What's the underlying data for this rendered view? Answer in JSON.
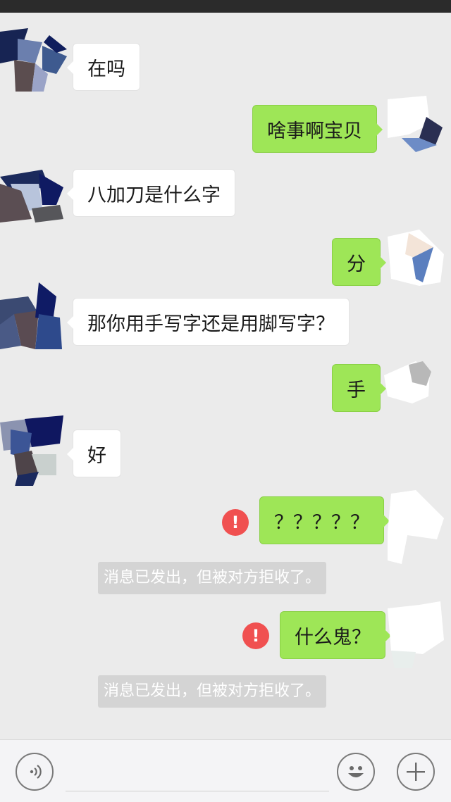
{
  "messages": [
    {
      "side": "in",
      "text": "在吗"
    },
    {
      "side": "out",
      "text": "啥事啊宝贝"
    },
    {
      "side": "in",
      "text": "八加刀是什么字"
    },
    {
      "side": "out",
      "text": "分"
    },
    {
      "side": "in",
      "text": "那你用手写字还是用脚写字？"
    },
    {
      "side": "out",
      "text": "手"
    },
    {
      "side": "in",
      "text": "好"
    },
    {
      "side": "out",
      "text": "？？？？？",
      "status": "failed"
    },
    {
      "side": "out",
      "text": "什么鬼？",
      "status": "failed"
    }
  ],
  "system_notes": [
    "消息已发出，但被对方拒收了。",
    "消息已发出，但被对方拒收了。"
  ],
  "error_icon_glyph": "!",
  "input_bar": {
    "voice_icon": "voice-icon",
    "emoji_icon": "emoji-icon",
    "plus_icon": "plus-icon",
    "text_value": ""
  },
  "colors": {
    "sent_bubble": "#9ee657",
    "received_bubble": "#ffffff",
    "error": "#f05050",
    "background": "#ebebeb"
  }
}
